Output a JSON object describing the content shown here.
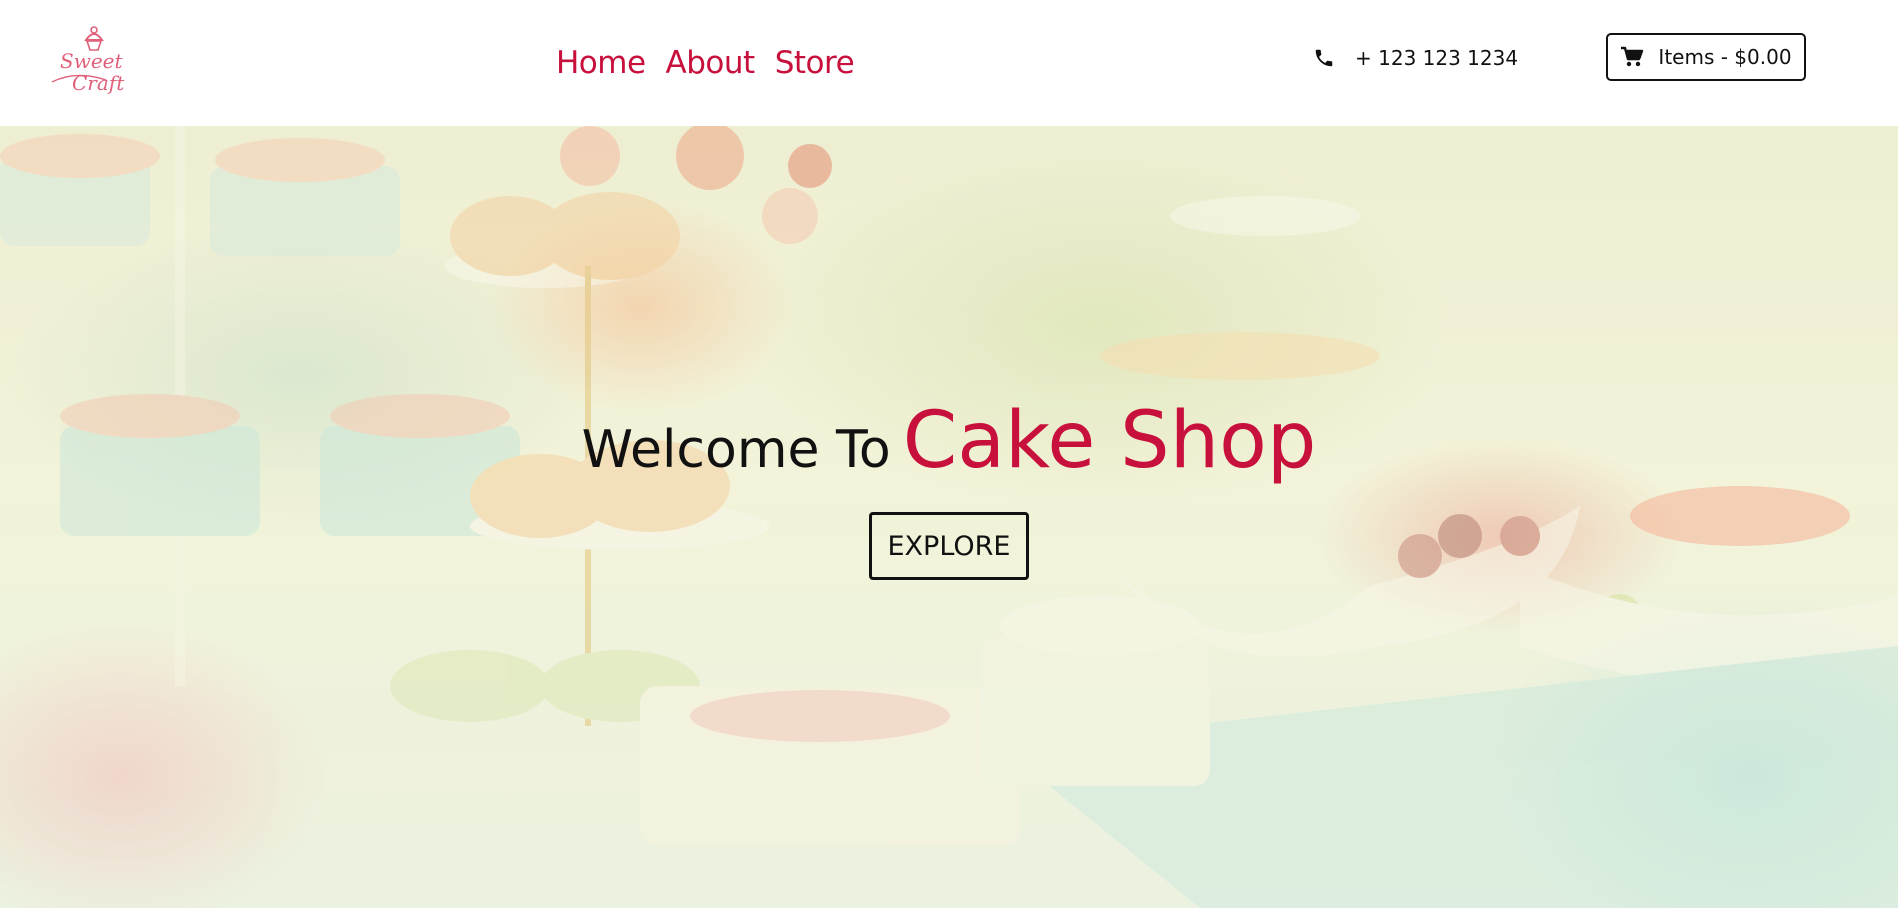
{
  "header": {
    "logo_text_line1": "Sweet",
    "logo_text_line2": "Craft",
    "nav": [
      {
        "label": "Home"
      },
      {
        "label": "About"
      },
      {
        "label": "Store"
      }
    ],
    "phone": {
      "icon": "phone-icon",
      "number": "+ 123 123 1234"
    },
    "cart": {
      "icon": "cart-icon",
      "label": "Items - $0.00"
    }
  },
  "hero": {
    "welcome": "Welcome To",
    "brand": "Cake Shop",
    "cta_label": "EXPLORE"
  },
  "colors": {
    "accent": "#c8103d",
    "text": "#111111",
    "background": "#ffffff"
  }
}
